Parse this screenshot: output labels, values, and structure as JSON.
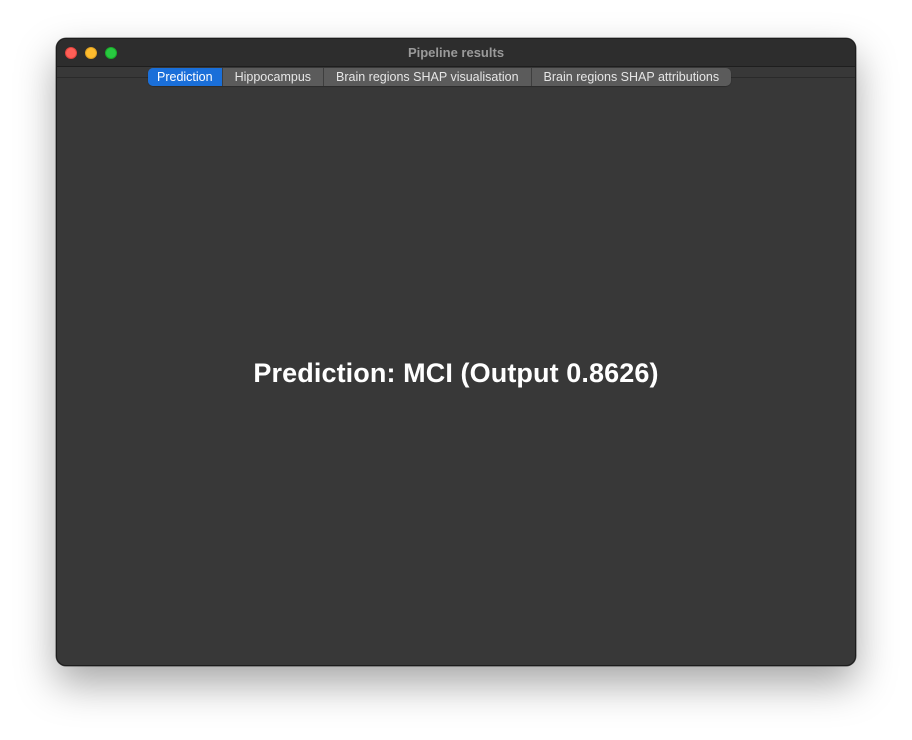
{
  "window": {
    "title": "Pipeline results"
  },
  "tabs": [
    {
      "label": "Prediction",
      "selected": true
    },
    {
      "label": "Hippocampus",
      "selected": false
    },
    {
      "label": "Brain regions SHAP visualisation",
      "selected": false
    },
    {
      "label": "Brain regions SHAP attributions",
      "selected": false
    }
  ],
  "main": {
    "prediction_text": "Prediction: MCI (Output 0.8626)"
  },
  "colors": {
    "accent": "#1a6fd9",
    "window_background": "#383838",
    "text": "#ffffff"
  },
  "icons": {
    "close": "close-icon",
    "minimize": "minimize-icon",
    "zoom": "zoom-icon"
  }
}
